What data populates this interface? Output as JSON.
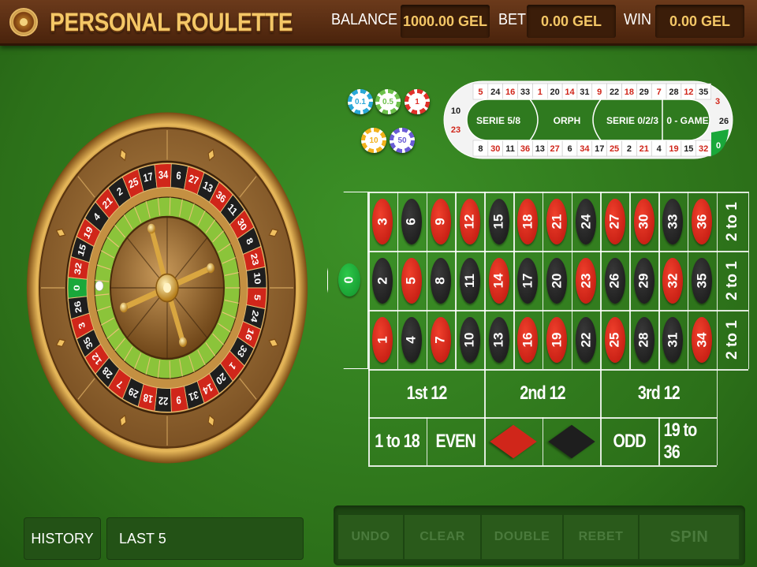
{
  "header": {
    "title": "PERSONAL ROULETTE",
    "balance_label": "BALANCE",
    "balance_value": "1000.00 GEL",
    "bet_label": "BET",
    "bet_value": "0.00 GEL",
    "win_label": "WIN",
    "win_value": "0.00 GEL"
  },
  "wheel": {
    "sequence": [
      "0",
      "32",
      "15",
      "19",
      "4",
      "21",
      "2",
      "25",
      "17",
      "34",
      "6",
      "27",
      "13",
      "36",
      "11",
      "30",
      "8",
      "23",
      "10",
      "5",
      "24",
      "16",
      "33",
      "1",
      "20",
      "14",
      "31",
      "9",
      "22",
      "18",
      "29",
      "7",
      "28",
      "12",
      "35",
      "3",
      "26"
    ]
  },
  "chips": [
    {
      "label": "0.1",
      "color": "#2aa8d8"
    },
    {
      "label": "0.5",
      "color": "#6cc04a"
    },
    {
      "label": "1",
      "color": "#e0302a"
    },
    {
      "label": "10",
      "color": "#f2b21c"
    },
    {
      "label": "50",
      "color": "#6a5bd6"
    }
  ],
  "racetrack": {
    "top_row": [
      "5",
      "24",
      "16",
      "33",
      "1",
      "20",
      "14",
      "31",
      "9",
      "22",
      "18",
      "29",
      "7",
      "28",
      "12",
      "35"
    ],
    "bottom_row": [
      "8",
      "30",
      "11",
      "36",
      "13",
      "27",
      "6",
      "34",
      "17",
      "25",
      "2",
      "21",
      "4",
      "19",
      "15",
      "32"
    ],
    "left_cap": [
      "10",
      "23"
    ],
    "right_cap": [
      "3",
      "26",
      "0"
    ],
    "sections": [
      "SERIE 5/8",
      "ORPH",
      "SERIE 0/2/3",
      "0 - GAME"
    ]
  },
  "table": {
    "zero": "0",
    "rows": [
      [
        "3",
        "6",
        "9",
        "12",
        "15",
        "18",
        "21",
        "24",
        "27",
        "30",
        "33",
        "36"
      ],
      [
        "2",
        "5",
        "8",
        "11",
        "14",
        "17",
        "20",
        "23",
        "26",
        "29",
        "32",
        "35"
      ],
      [
        "1",
        "4",
        "7",
        "10",
        "13",
        "16",
        "19",
        "22",
        "25",
        "28",
        "31",
        "34"
      ]
    ],
    "red_numbers": [
      "1",
      "3",
      "5",
      "7",
      "9",
      "12",
      "14",
      "16",
      "18",
      "19",
      "21",
      "23",
      "25",
      "27",
      "30",
      "32",
      "34",
      "36"
    ],
    "column_bets": [
      "2 to 1",
      "2 to 1",
      "2 to 1"
    ],
    "dozens": [
      "1st 12",
      "2nd 12",
      "3rd 12"
    ],
    "even_money": {
      "low": "1 to 18",
      "even": "EVEN",
      "odd": "ODD",
      "high": "19 to 36"
    }
  },
  "bottom": {
    "history_label": "HISTORY",
    "last5_label": "LAST 5",
    "undo_label": "UNDO",
    "clear_label": "CLEAR",
    "double_label": "DOUBLE",
    "rebet_label": "REBET",
    "spin_label": "SPIN"
  },
  "colors": {
    "red": "#d0261a",
    "black": "#1e1e1e",
    "green": "#1aa83a",
    "gold": "#f4c766"
  }
}
